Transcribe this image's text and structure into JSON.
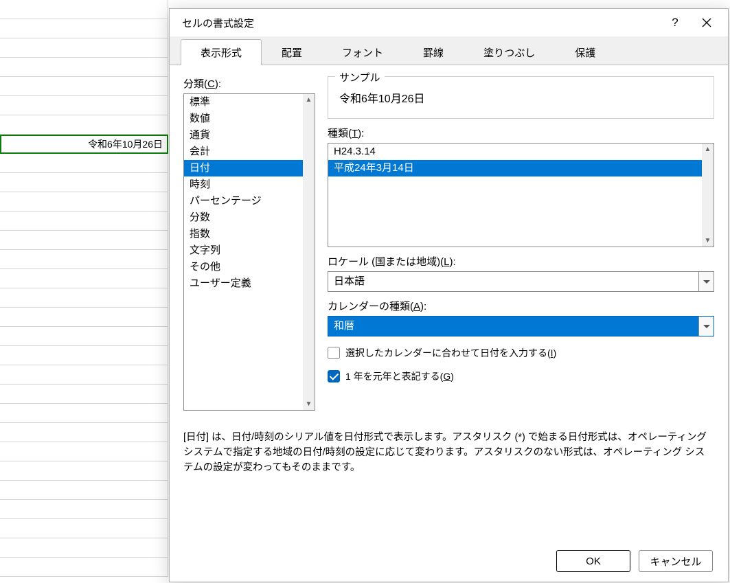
{
  "cell_value": "令和6年10月26日",
  "dialog": {
    "title": "セルの書式設定",
    "tabs": [
      "表示形式",
      "配置",
      "フォント",
      "罫線",
      "塗りつぶし",
      "保護"
    ],
    "category_label_pre": "分類(",
    "category_label_key": "C",
    "category_label_post": "):",
    "categories": [
      "標準",
      "数値",
      "通貨",
      "会計",
      "日付",
      "時刻",
      "パーセンテージ",
      "分数",
      "指数",
      "文字列",
      "その他",
      "ユーザー定義"
    ],
    "selected_category_index": 4,
    "sample_label": "サンプル",
    "sample_value": "令和6年10月26日",
    "type_label_pre": "種類(",
    "type_label_key": "T",
    "type_label_post": "):",
    "type_items": [
      "H24.3.14",
      "平成24年3月14日"
    ],
    "selected_type_index": 1,
    "locale_label_pre": "ロケール (国または地域)(",
    "locale_label_key": "L",
    "locale_label_post": "):",
    "locale_value": "日本語",
    "calendar_label_pre": "カレンダーの種類(",
    "calendar_label_key": "A",
    "calendar_label_post": "):",
    "calendar_value": "和暦",
    "check1_pre": "選択したカレンダーに合わせて日付を入力する(",
    "check1_key": "I",
    "check1_post": ")",
    "check2_pre": "1 年を元年と表記する(",
    "check2_key": "G",
    "check2_post": ")",
    "description": "[日付] は、日付/時刻のシリアル値を日付形式で表示します。アスタリスク (*) で始まる日付形式は、オペレーティング システムで指定する地域の日付/時刻の設定に応じて変わります。アスタリスクのない形式は、オペレーティング システムの設定が変わってもそのままです。",
    "ok": "OK",
    "cancel": "キャンセル"
  }
}
